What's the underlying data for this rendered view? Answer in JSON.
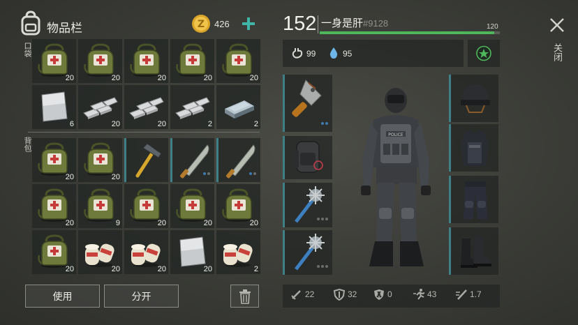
{
  "inventory": {
    "title": "物品栏",
    "coins": "426",
    "section_pocket": "口袋",
    "section_backpack": "背包",
    "pocket_slots": [
      {
        "item": "medkit-bag",
        "count": "20"
      },
      {
        "item": "medkit-bag",
        "count": "20"
      },
      {
        "item": "medkit-bag",
        "count": "20"
      },
      {
        "item": "medkit-bag",
        "count": "20"
      },
      {
        "item": "medkit-bag",
        "count": "20"
      },
      {
        "item": "metal-sheet",
        "count": "6"
      },
      {
        "item": "iron-bars",
        "count": "20"
      },
      {
        "item": "iron-bars",
        "count": "20"
      },
      {
        "item": "iron-bars",
        "count": "2"
      },
      {
        "item": "steel-ingot",
        "count": "2"
      }
    ],
    "backpack_slots": [
      {
        "item": "medkit-bag",
        "count": "20"
      },
      {
        "item": "medkit-bag",
        "count": "20"
      },
      {
        "item": "hammer",
        "count": ""
      },
      {
        "item": "machete",
        "count": ""
      },
      {
        "item": "machete",
        "count": ""
      },
      {
        "item": "medkit-bag",
        "count": "20"
      },
      {
        "item": "medkit-bag",
        "count": "9"
      },
      {
        "item": "medkit-bag",
        "count": "20"
      },
      {
        "item": "medkit-bag",
        "count": "20"
      },
      {
        "item": "medkit-bag",
        "count": "20"
      },
      {
        "item": "medkit-bag",
        "count": "20"
      },
      {
        "item": "bandage",
        "count": "20"
      },
      {
        "item": "bandage",
        "count": "20"
      },
      {
        "item": "metal-sheet",
        "count": "20"
      },
      {
        "item": "bandage",
        "count": "2"
      }
    ],
    "use_label": "使用",
    "split_label": "分开"
  },
  "character": {
    "level": "152",
    "name": "一身是肝",
    "tag": "#9128",
    "xp_value": "120",
    "xp_fraction": 0.97,
    "hunger": "99",
    "thirst": "95",
    "colors": {
      "xp": "#4fb75b",
      "accent": "#3f7f86",
      "water": "#6fb6e8"
    }
  },
  "stats": [
    {
      "icon": "sword-icon",
      "value": "22"
    },
    {
      "icon": "shield-icon",
      "value": "32"
    },
    {
      "icon": "radiation-icon",
      "value": "0"
    },
    {
      "icon": "running-icon",
      "value": "43"
    },
    {
      "icon": "blade-speed-icon",
      "value": "1.7"
    }
  ],
  "close_label": "关闭"
}
